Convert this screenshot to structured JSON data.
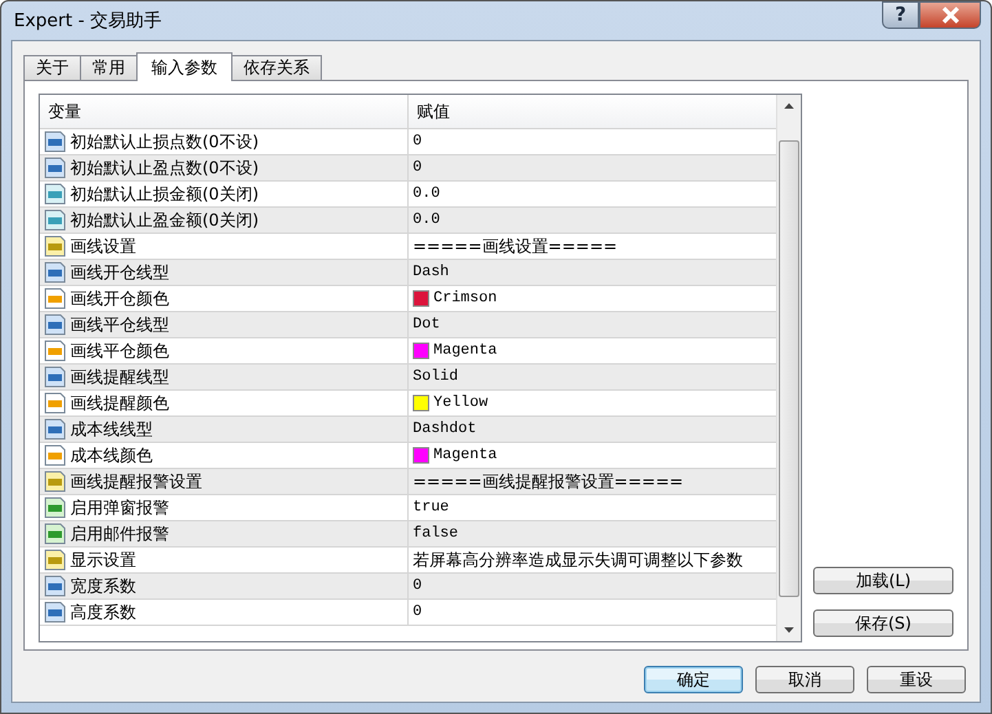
{
  "window": {
    "title": "Expert - 交易助手",
    "help": "?"
  },
  "tabs": [
    {
      "label": "关于",
      "selected": false
    },
    {
      "label": "常用",
      "selected": false
    },
    {
      "label": "输入参数",
      "selected": true
    },
    {
      "label": "依存关系",
      "selected": false
    }
  ],
  "table": {
    "columns": [
      "变量",
      "赋值"
    ],
    "rows": [
      {
        "kind": "int",
        "name": "初始默认止损点数(0不设)",
        "value": "0"
      },
      {
        "kind": "int",
        "name": "初始默认止盈点数(0不设)",
        "value": "0"
      },
      {
        "kind": "double",
        "name": "初始默认止损金额(0关闭)",
        "value": "0.0"
      },
      {
        "kind": "double",
        "name": "初始默认止盈金额(0关闭)",
        "value": "0.0"
      },
      {
        "kind": "string",
        "name": "画线设置",
        "value": "=====画线设置====="
      },
      {
        "kind": "int",
        "name": "画线开仓线型",
        "value": "Dash"
      },
      {
        "kind": "color",
        "name": "画线开仓颜色",
        "value": "Crimson",
        "color": "#dc143c"
      },
      {
        "kind": "int",
        "name": "画线平仓线型",
        "value": "Dot"
      },
      {
        "kind": "color",
        "name": "画线平仓颜色",
        "value": "Magenta",
        "color": "#ff00ff"
      },
      {
        "kind": "int",
        "name": "画线提醒线型",
        "value": "Solid"
      },
      {
        "kind": "color",
        "name": "画线提醒颜色",
        "value": "Yellow",
        "color": "#ffff00"
      },
      {
        "kind": "int",
        "name": "成本线线型",
        "value": "Dashdot"
      },
      {
        "kind": "color",
        "name": "成本线颜色",
        "value": "Magenta",
        "color": "#ff00ff"
      },
      {
        "kind": "string",
        "name": "画线提醒报警设置",
        "value": "=====画线提醒报警设置====="
      },
      {
        "kind": "bool",
        "name": "启用弹窗报警",
        "value": "true"
      },
      {
        "kind": "bool",
        "name": "启用邮件报警",
        "value": "false"
      },
      {
        "kind": "string",
        "name": "显示设置",
        "value": "若屏幕高分辨率造成显示失调可调整以下参数"
      },
      {
        "kind": "int",
        "name": "宽度系数",
        "value": "0"
      },
      {
        "kind": "int",
        "name": "高度系数",
        "value": "0"
      }
    ]
  },
  "side_buttons": [
    "加载(L)",
    "保存(S)"
  ],
  "buttons": [
    {
      "label": "确定",
      "default": true
    },
    {
      "label": "取消",
      "default": false
    },
    {
      "label": "重设",
      "default": false
    }
  ]
}
